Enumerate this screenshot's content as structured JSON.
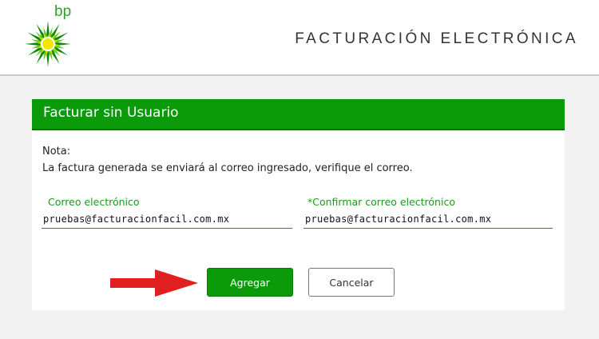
{
  "header": {
    "logo_text": "bp",
    "title": "FACTURACIÓN ELECTRÓNICA"
  },
  "panel": {
    "title": "Facturar sin Usuario",
    "note_label": "Nota:",
    "note_text": "La factura generada se enviará al correo ingresado, verifique el correo."
  },
  "form": {
    "email_label": "Correo electrónico",
    "email_value": "pruebas@facturacionfacil.com.mx",
    "confirm_label": "*Confirmar correo electrónico",
    "confirm_value": "pruebas@facturacionfacil.com.mx"
  },
  "buttons": {
    "add_label": "Agregar",
    "cancel_label": "Cancelar"
  },
  "colors": {
    "brand_green": "#0a9a0a",
    "logo_yellow": "#f5e600",
    "arrow_red": "#e02020"
  },
  "icons": {
    "logo": "bp-helios-logo-icon",
    "arrow": "red-arrow-right-icon"
  }
}
